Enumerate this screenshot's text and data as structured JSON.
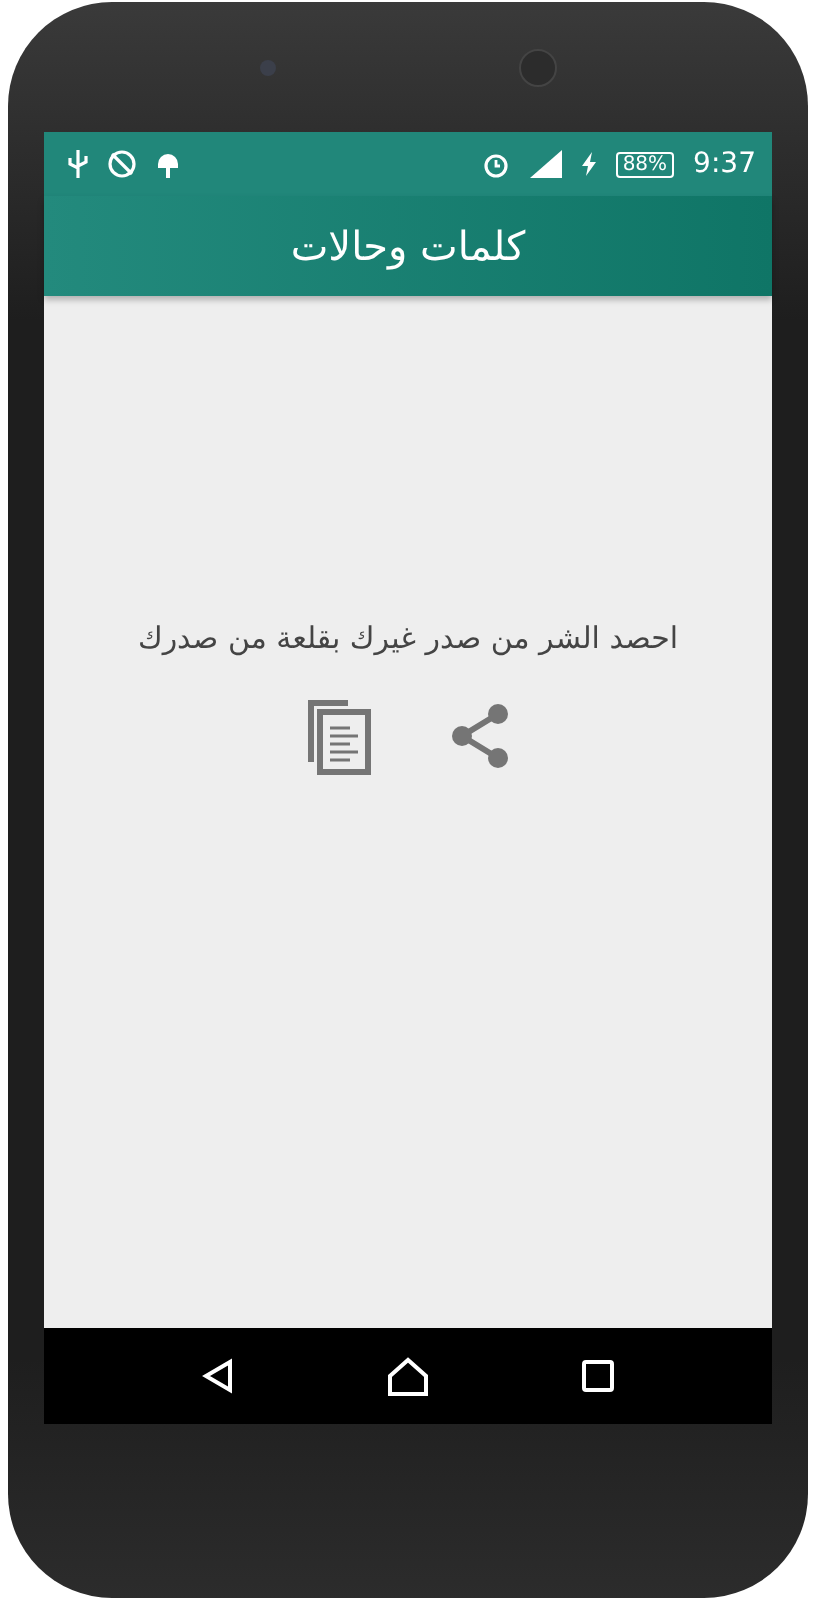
{
  "status_bar": {
    "battery": "88%",
    "time": "9:37"
  },
  "app_bar": {
    "title": "كلمات وحالات"
  },
  "quote": {
    "text": "احصد الشر من صدر غيرك بقلعة من صدرك"
  }
}
